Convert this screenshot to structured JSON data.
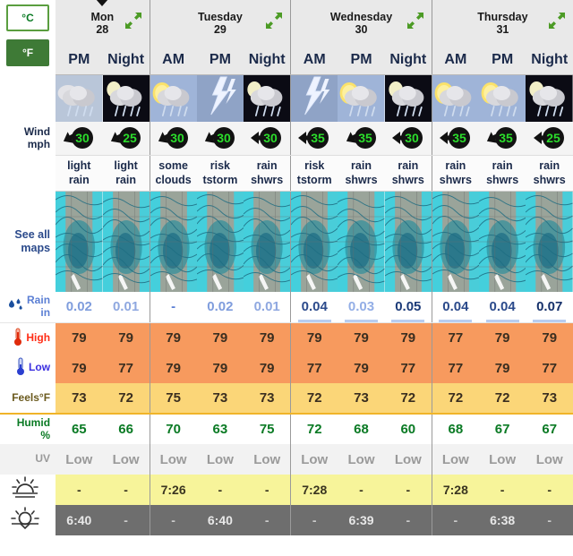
{
  "units": {
    "celsius_label": "°C",
    "fahrenheit_label": "°F",
    "active": "°F"
  },
  "row_labels": {
    "wind": "Wind",
    "wind_unit": "mph",
    "maps": "See all",
    "maps2": "maps",
    "rain": "Rain",
    "rain_unit": "in",
    "high": "High",
    "low": "Low",
    "feels": "Feels°F",
    "humid": "Humid",
    "humid_unit": "%",
    "uv": "UV"
  },
  "icons": {
    "raindrop": "raindrop-icon",
    "thermometer_high": "thermometer-high-icon",
    "thermometer_low": "thermometer-low-icon",
    "sunrise": "sunrise-icon",
    "sunset": "sunset-icon",
    "expand": "expand-arrows-icon"
  },
  "days": [
    {
      "name": "Mon",
      "date": "28",
      "selected": true,
      "periods": [
        "PM",
        "Night"
      ]
    },
    {
      "name": "Tuesday",
      "date": "29",
      "selected": false,
      "periods": [
        "AM",
        "PM",
        "Night"
      ]
    },
    {
      "name": "Wednesday",
      "date": "30",
      "selected": false,
      "periods": [
        "AM",
        "PM",
        "Night"
      ]
    },
    {
      "name": "Thursday",
      "date": "31",
      "selected": false,
      "periods": [
        "AM",
        "PM",
        "Night"
      ]
    }
  ],
  "columns": [
    {
      "day": 0,
      "period": "PM",
      "night": false,
      "icon": "rain",
      "wind": "30",
      "wind_dir": "SW",
      "cond1": "light",
      "cond2": "rain",
      "rain": "0.02",
      "rain_level": 2,
      "high": "79",
      "low": "79",
      "feels": "73",
      "humid": "65",
      "uv": "Low",
      "sunrise": "-",
      "sunset": "6:40"
    },
    {
      "day": 0,
      "period": "Night",
      "night": true,
      "icon": "rain-night",
      "wind": "25",
      "wind_dir": "SW",
      "cond1": "light",
      "cond2": "rain",
      "rain": "0.01",
      "rain_level": 1,
      "high": "79",
      "low": "77",
      "feels": "72",
      "humid": "66",
      "uv": "Low",
      "sunrise": "-",
      "sunset": "-"
    },
    {
      "day": 1,
      "period": "AM",
      "night": false,
      "icon": "partly",
      "wind": "30",
      "wind_dir": "SW",
      "cond1": "some",
      "cond2": "clouds",
      "rain": "-",
      "rain_level": 0,
      "high": "79",
      "low": "79",
      "feels": "75",
      "humid": "70",
      "uv": "Low",
      "sunrise": "7:26",
      "sunset": "-"
    },
    {
      "day": 1,
      "period": "PM",
      "night": false,
      "icon": "storm",
      "wind": "30",
      "wind_dir": "SW",
      "cond1": "risk",
      "cond2": "tstorm",
      "rain": "0.02",
      "rain_level": 2,
      "high": "79",
      "low": "79",
      "feels": "73",
      "humid": "63",
      "uv": "Low",
      "sunrise": "-",
      "sunset": "6:40"
    },
    {
      "day": 1,
      "period": "Night",
      "night": true,
      "icon": "rain-night",
      "wind": "30",
      "wind_dir": "W",
      "cond1": "rain",
      "cond2": "shwrs",
      "rain": "0.01",
      "rain_level": 1,
      "high": "79",
      "low": "79",
      "feels": "73",
      "humid": "75",
      "uv": "Low",
      "sunrise": "-",
      "sunset": "-"
    },
    {
      "day": 2,
      "period": "AM",
      "night": false,
      "icon": "storm",
      "wind": "35",
      "wind_dir": "W",
      "cond1": "risk",
      "cond2": "tstorm",
      "rain": "0.04",
      "rain_level": 4,
      "high": "79",
      "low": "77",
      "feels": "72",
      "humid": "72",
      "uv": "Low",
      "sunrise": "7:28",
      "sunset": "-"
    },
    {
      "day": 2,
      "period": "PM",
      "night": false,
      "icon": "partly",
      "wind": "35",
      "wind_dir": "SW",
      "cond1": "rain",
      "cond2": "shwrs",
      "rain": "0.03",
      "rain_level": 3,
      "high": "79",
      "low": "79",
      "feels": "73",
      "humid": "68",
      "uv": "Low",
      "sunrise": "-",
      "sunset": "6:39"
    },
    {
      "day": 2,
      "period": "Night",
      "night": true,
      "icon": "rain-night",
      "wind": "30",
      "wind_dir": "W",
      "cond1": "rain",
      "cond2": "shwrs",
      "rain": "0.05",
      "rain_level": 5,
      "high": "79",
      "low": "77",
      "feels": "72",
      "humid": "60",
      "uv": "Low",
      "sunrise": "-",
      "sunset": "-"
    },
    {
      "day": 3,
      "period": "AM",
      "night": false,
      "icon": "partly",
      "wind": "35",
      "wind_dir": "W",
      "cond1": "rain",
      "cond2": "shwrs",
      "rain": "0.04",
      "rain_level": 4,
      "high": "77",
      "low": "77",
      "feels": "72",
      "humid": "68",
      "uv": "Low",
      "sunrise": "7:28",
      "sunset": "-"
    },
    {
      "day": 3,
      "period": "PM",
      "night": false,
      "icon": "partly",
      "wind": "35",
      "wind_dir": "SW",
      "cond1": "rain",
      "cond2": "shwrs",
      "rain": "0.04",
      "rain_level": 4,
      "high": "79",
      "low": "79",
      "feels": "72",
      "humid": "67",
      "uv": "Low",
      "sunrise": "-",
      "sunset": "6:38"
    },
    {
      "day": 3,
      "period": "Night",
      "night": true,
      "icon": "rain-night",
      "wind": "25",
      "wind_dir": "W",
      "cond1": "rain",
      "cond2": "shwrs",
      "rain": "0.07",
      "rain_level": 6,
      "high": "79",
      "low": "77",
      "feels": "73",
      "humid": "67",
      "uv": "Low",
      "sunrise": "-",
      "sunset": "-"
    }
  ],
  "colors": {
    "wind_badge_bg": "#121212",
    "wind_badge_text": "#2bdd2b",
    "high_bg": "#f79a5e",
    "feels_bg": "#fbd678",
    "sunrise_bg": "#f7f49a",
    "sunset_bg": "#6e6e6e",
    "humid_text": "#0a7a24",
    "rain_text": "#5b7fd4",
    "link": "#2b4a8b",
    "active_unit_bg": "#3e7a36"
  }
}
